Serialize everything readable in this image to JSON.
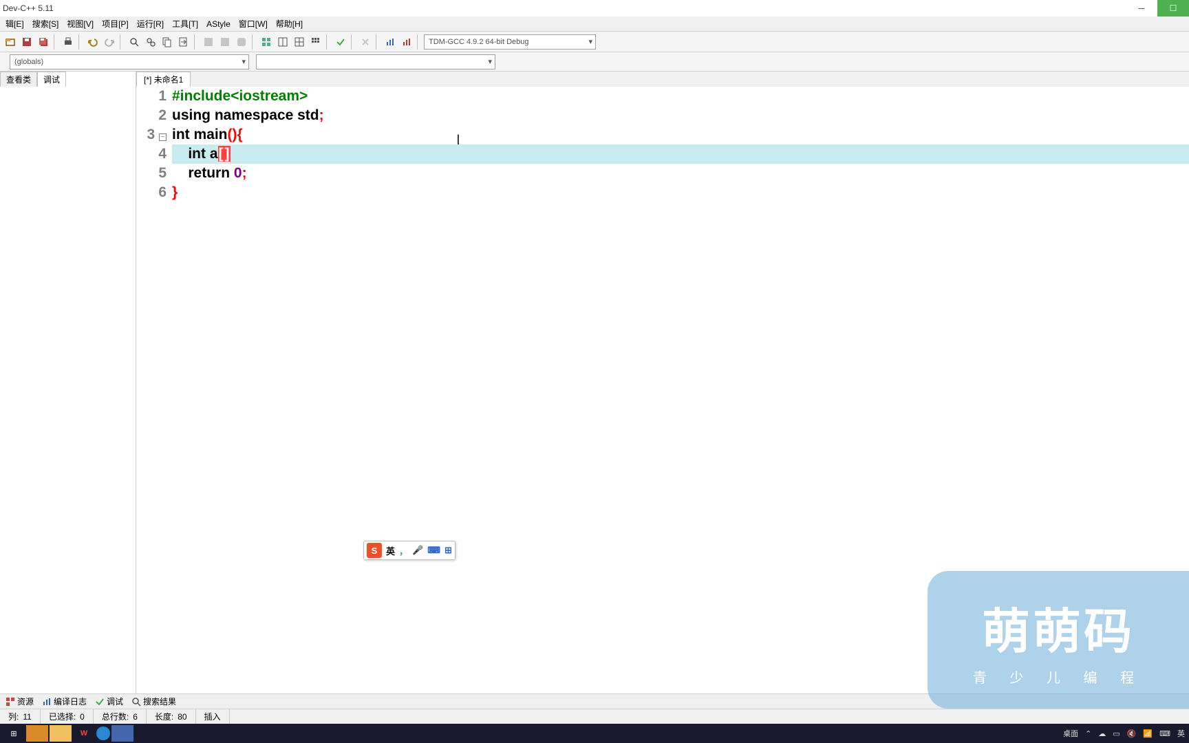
{
  "title": "Dev-C++ 5.11",
  "menus": {
    "edit": "辑[E]",
    "search": "搜索[S]",
    "view": "视图[V]",
    "project": "项目[P]",
    "run": "运行[R]",
    "tools": "工具[T]",
    "astyle": "AStyle",
    "window": "窗口[W]",
    "help": "帮助[H]"
  },
  "compiler_combo": "TDM-GCC 4.9.2 64-bit Debug",
  "scope_combo": "(globals)",
  "left_tabs": {
    "classes": "查看类",
    "debug": "调试"
  },
  "file_tab": "[*] 未命名1",
  "code": {
    "lines": [
      {
        "n": "1",
        "tokens": [
          [
            "pp",
            "#include"
          ],
          [
            "pp",
            "<iostream>"
          ]
        ]
      },
      {
        "n": "2",
        "tokens": [
          [
            "kw",
            "using"
          ],
          [
            "txt",
            " "
          ],
          [
            "kw",
            "namespace"
          ],
          [
            "txt",
            " "
          ],
          [
            "txt",
            "std"
          ],
          [
            "sym",
            ";"
          ]
        ]
      },
      {
        "n": "3",
        "fold": true,
        "tokens": [
          [
            "kw",
            "int"
          ],
          [
            "txt",
            " "
          ],
          [
            "txt",
            "main"
          ],
          [
            "sym",
            "()"
          ],
          [
            "sym",
            "{"
          ]
        ]
      },
      {
        "n": "4",
        "hl": true,
        "tokens": [
          [
            "txt",
            "    "
          ],
          [
            "kw",
            "int"
          ],
          [
            "txt",
            " a"
          ],
          [
            "bh",
            "["
          ],
          [
            "bh",
            "]"
          ]
        ]
      },
      {
        "n": "5",
        "tokens": [
          [
            "txt",
            "    "
          ],
          [
            "kw",
            "return"
          ],
          [
            "txt",
            " "
          ],
          [
            "num",
            "0"
          ],
          [
            "sym",
            ";"
          ]
        ]
      },
      {
        "n": "6",
        "tokens": [
          [
            "sym",
            "}"
          ]
        ]
      }
    ]
  },
  "ime": {
    "lang": "英",
    "punct": "，"
  },
  "bottom": {
    "res": "资源",
    "log": "编译日志",
    "debug": "调试",
    "find": "搜索结果"
  },
  "status": {
    "col_lbl": "列:",
    "col": "11",
    "sel_lbl": "已选择:",
    "sel": "0",
    "total_lbl": "总行数:",
    "total": "6",
    "len_lbl": "长度:",
    "len": "80",
    "mode": "插入"
  },
  "tray": {
    "desktop": "桌面",
    "ime": "英"
  },
  "watermark": {
    "main": "萌萌码",
    "sub": "青 少 儿 编 程"
  }
}
